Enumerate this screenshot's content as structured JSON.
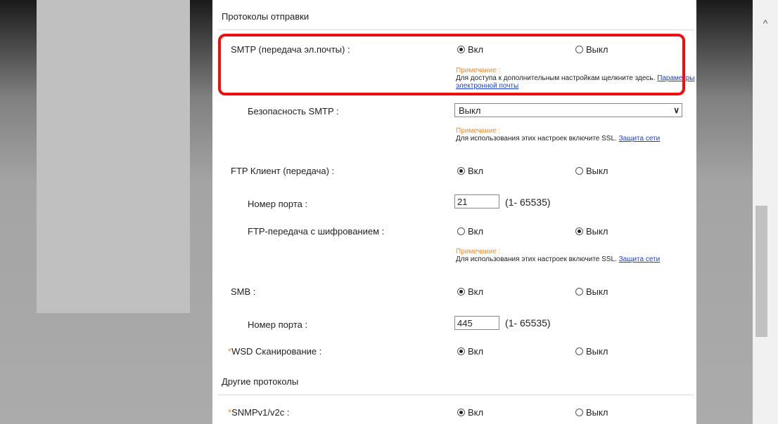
{
  "sections": {
    "send_protocols": "Протоколы отправки",
    "other_protocols": "Другие протоколы"
  },
  "options": {
    "on": "Вкл",
    "off": "Выкл"
  },
  "smtp": {
    "label": "SMTP (передача эл.почты) :",
    "value": "on"
  },
  "note_smtp": {
    "head": "Примечание :",
    "body": "Для доступа к дополнительным настройкам щелкните здесь.",
    "link": "Параметры электронной почты"
  },
  "smtp_security": {
    "label": "Безопасность SMTP :",
    "selected": "Выкл"
  },
  "note_ssl_1": {
    "head": "Примечание :",
    "body": "Для использования этих настроек включите SSL.",
    "link": "Защита сети"
  },
  "ftp_client": {
    "label": "FTP Клиент (передача) :",
    "value": "on"
  },
  "ftp_port": {
    "label": "Номер порта :",
    "value": "21",
    "range": "(1- 65535)"
  },
  "ftp_encrypted": {
    "label": "FTP-передача с шифрованием :",
    "value": "off"
  },
  "note_ssl_2": {
    "head": "Примечание :",
    "body": "Для использования этих настроек включите SSL.",
    "link": "Защита сети"
  },
  "smb": {
    "label": "SMB :",
    "value": "on"
  },
  "smb_port": {
    "label": "Номер порта :",
    "value": "445",
    "range": "(1- 65535)"
  },
  "wsd_scan": {
    "asterisk": "*",
    "label": "WSD Сканирование :",
    "value": "on"
  },
  "snmp": {
    "asterisk": "*",
    "label": "SNMPv1/v2c :",
    "value": "on"
  },
  "scrollbar": {
    "up_arrow": "^"
  },
  "colors": {
    "highlight": "#ee1010",
    "note": "#f08c30",
    "link": "#1a3fcc"
  }
}
